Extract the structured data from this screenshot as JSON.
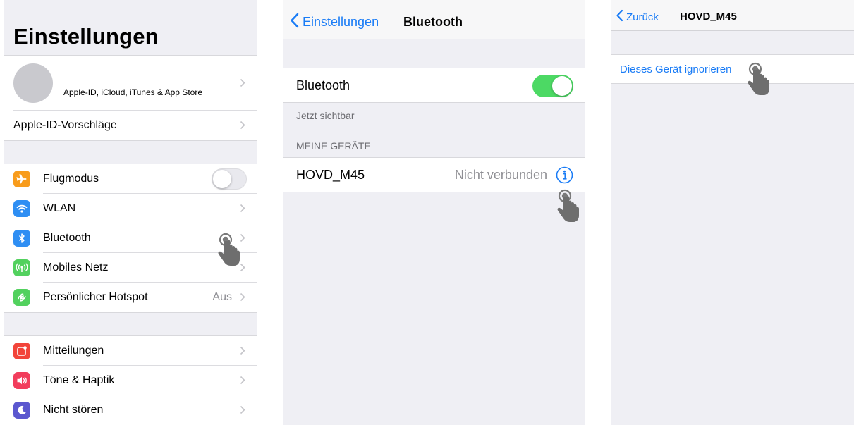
{
  "panel1": {
    "title": "Einstellungen",
    "account": {
      "label": "Apple-ID, iCloud, iTunes & App Store"
    },
    "suggestions": {
      "label": "Apple-ID-Vorschläge"
    },
    "connectivity": [
      {
        "label": "Flugmodus",
        "icon": "airplane-icon",
        "color": "#f89c1c",
        "control": "toggle-off"
      },
      {
        "label": "WLAN",
        "icon": "wifi-icon",
        "color": "#2e8ef3",
        "control": "chevron"
      },
      {
        "label": "Bluetooth",
        "icon": "bluetooth-icon",
        "color": "#2e8ef3",
        "control": "chevron"
      },
      {
        "label": "Mobiles Netz",
        "icon": "antenna-icon",
        "color": "#52d15e",
        "control": "chevron"
      },
      {
        "label": "Persönlicher Hotspot",
        "icon": "hotspot-icon",
        "color": "#52d15e",
        "control": "chevron",
        "value": "Aus"
      }
    ],
    "notifications": [
      {
        "label": "Mitteilungen",
        "icon": "notifications-icon",
        "color": "#f2443a"
      },
      {
        "label": "Töne & Haptik",
        "icon": "sound-icon",
        "color": "#f23d5c"
      },
      {
        "label": "Nicht stören",
        "icon": "moon-icon",
        "color": "#5b57cf"
      }
    ]
  },
  "panel2": {
    "back_label": "Einstellungen",
    "title": "Bluetooth",
    "bluetooth_label": "Bluetooth",
    "bluetooth_on": true,
    "visible_caption": "Jetzt sichtbar",
    "section_header": "MEINE GERÄTE",
    "device": {
      "name": "HOVD_M45",
      "status": "Nicht verbunden"
    }
  },
  "panel3": {
    "back_label": "Zurück",
    "title": "HOVD_M45",
    "forget_label": "Dieses Gerät ignorieren"
  },
  "colors": {
    "accent": "#1a7cf6",
    "switch_on": "#4cd964",
    "background": "#efeff4"
  }
}
